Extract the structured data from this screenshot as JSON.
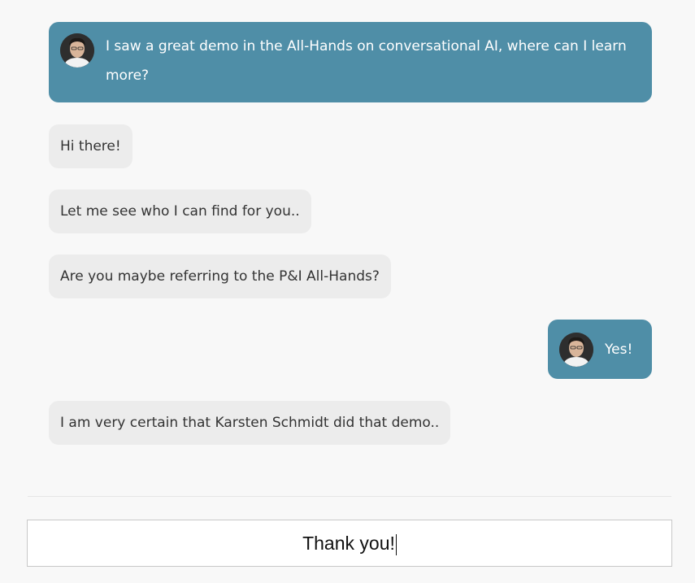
{
  "conversation": {
    "messages": [
      {
        "role": "user",
        "text": "I saw a great demo in the All-Hands on conversational AI, where can I learn more?"
      },
      {
        "role": "bot",
        "text": "Hi there!"
      },
      {
        "role": "bot",
        "text": "Let me see who I can find for you.."
      },
      {
        "role": "bot",
        "text": "Are you maybe referring to the P&I All-Hands?"
      },
      {
        "role": "user",
        "text": "Yes!"
      },
      {
        "role": "bot",
        "text": "I am very certain that Karsten Schmidt did that demo.."
      }
    ]
  },
  "composer": {
    "value": "Thank you!"
  },
  "colors": {
    "user_bubble": "#4f8ea7",
    "bot_bubble": "#ececec",
    "background": "#f8f8f8"
  },
  "icons": {
    "avatar": "user-avatar-icon"
  }
}
